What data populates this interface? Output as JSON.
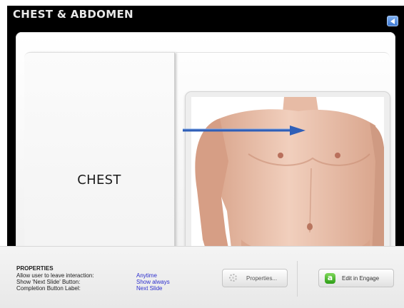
{
  "stage": {
    "title": "CHEST & ABDOMEN",
    "section_label": "CHEST"
  },
  "icons": {
    "back": "back-arrow-icon",
    "properties": "gear-icon",
    "engage": "engage-logo-icon"
  },
  "properties": {
    "heading": "PROPERTIES",
    "rows": [
      {
        "label": "Allow user to leave interaction:",
        "value": "Anytime"
      },
      {
        "label": "Show 'Next Slide' Button:",
        "value": "Show always"
      },
      {
        "label": "Completion Button Label:",
        "value": "Next Slide"
      }
    ],
    "properties_button": "Properties...",
    "engage_button": "Edit in Engage",
    "engage_icon_glyph": "a"
  },
  "colors": {
    "stage_bg": "#000000",
    "value_text": "#2c2ecd",
    "pointer_arrow": "#2f5fb8",
    "engage_green": "#2d9d17"
  }
}
